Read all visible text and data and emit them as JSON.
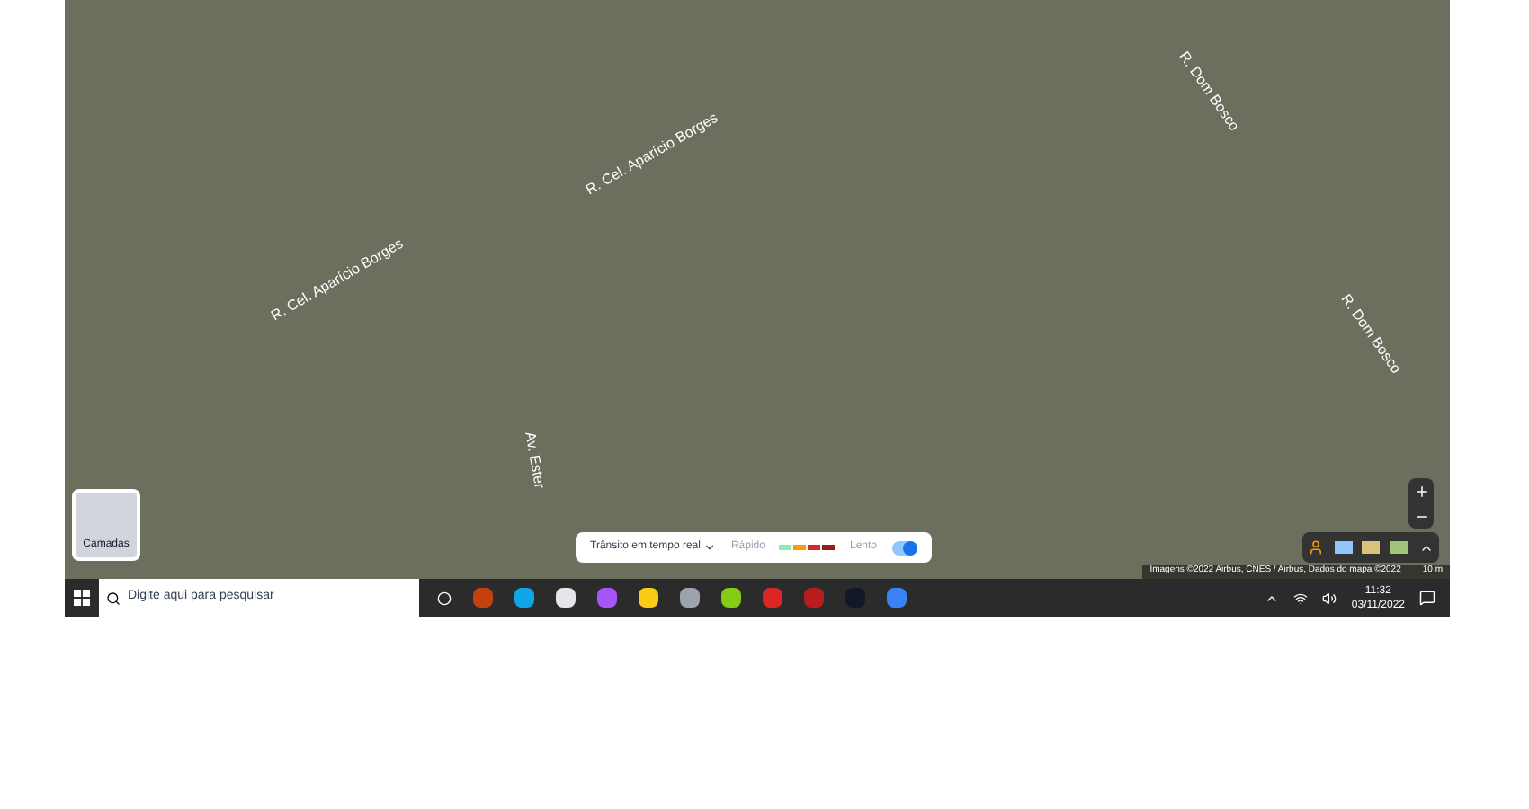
{
  "map": {
    "street_labels": [
      "R. Cel. Aparício Borges",
      "R. Cel. Aparício Borges",
      "R. Dom Bosco",
      "R. Dom Bosco",
      "Av. Ester"
    ],
    "layers_label": "Camadas",
    "traffic": {
      "label": "Trânsito em tempo real",
      "fast": "Rápido",
      "slow": "Lento",
      "on": true
    },
    "attribution": "Imagens ©2022 Airbus, CNES / Airbus, Dados do mapa ©2022",
    "scale": "10 m"
  },
  "taskbar": {
    "search_placeholder": "Digite aqui para pesquisar",
    "time": "11:32",
    "date": "03/11/2022"
  }
}
